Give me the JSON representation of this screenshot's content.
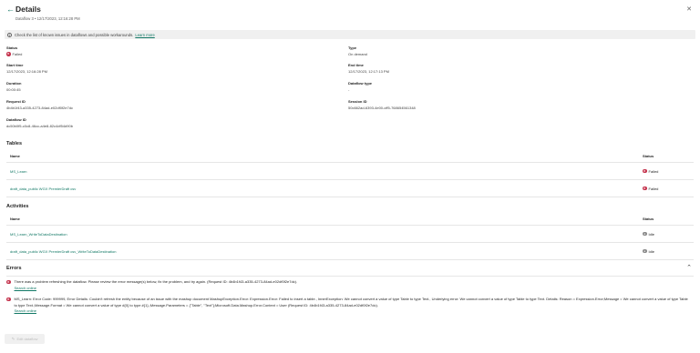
{
  "header": {
    "title": "Details",
    "subtitle": "Dataflow 3 • 12/17/2023, 12:16:28 PM",
    "back_glyph": "←",
    "close_glyph": "✕"
  },
  "banner": {
    "icon": "info-icon",
    "text": "Check the list of known issues in dataflows and possible workarounds.",
    "link": "Learn more"
  },
  "properties": {
    "status": {
      "label": "Status",
      "value": "Failed"
    },
    "type": {
      "label": "Type",
      "value": "On demand"
    },
    "start_time": {
      "label": "Start time",
      "value": "12/17/2023, 12:16:28 PM"
    },
    "end_time": {
      "label": "End time",
      "value": "12/17/2023, 12:17:13 PM"
    },
    "duration": {
      "label": "Duration",
      "value": "00:00:45"
    },
    "dataflow_type": {
      "label": "Dataflow type",
      "value": "-"
    },
    "request_id": {
      "label": "Request ID",
      "value": "4b4b1f43-a335-4273-84ad-e02df0f2e7dc"
    },
    "session_id": {
      "label": "Session ID",
      "value": "50c662ad-6393-4e00-cff5-768654561348"
    },
    "dataflow_id": {
      "label": "Dataflow ID",
      "value": "dc50b0f5-c0c8-46cc-a4e8-82c4df54d90b"
    }
  },
  "tables": {
    "title": "Tables",
    "headers": {
      "name": "Name",
      "status": "Status"
    },
    "rows": [
      {
        "name": "MS_Learn",
        "status": "Failed"
      },
      {
        "name": "draft_data_public WGX PremierDraft csv",
        "status": "Failed"
      }
    ]
  },
  "activities": {
    "title": "Activities",
    "headers": {
      "name": "Name",
      "status": "Status"
    },
    "rows": [
      {
        "name": "MS_Learn_WriteToDataDestination",
        "status": "Idle"
      },
      {
        "name": "draft_data_public WGX PremierDraft csv_WriteToDataDestination",
        "status": "Idle"
      }
    ]
  },
  "errors": {
    "title": "Errors",
    "items": [
      {
        "text": "There was a problem refreshing the dataflow. Please review the error message(s) below, fix the problem, and try again. (Request ID: 4b4b1f43-a335-4273-84ad-e02df0f2e7dc).",
        "link": "Search online"
      },
      {
        "text": "MS_Learn: Error Code: 999999, Error Details: Couldn't refresh the entity because of an issue with the mashup document MashupException.Error: Expression.Error: Failed to insert a table., InnerException: We cannot convert a value of type Table to type Text., Underlying error: We cannot convert a value of type Table to type Text. Details: Reason = Expression.Error;Message = We cannot convert a value of type Table to type Text.;Message.Format = We cannot convert a value of type #{0} to type #{1}.;Message.Parameters = {\"Table\", \"Text\"};Microsoft.Data.Mashup.Error.Context = User (Request ID: 4b4b1f43-a335-4273-84ad-e02df0f2e7dc).",
        "link": "Search online"
      }
    ]
  },
  "footer": {
    "edit_button": "Edit dataflow"
  },
  "colors": {
    "accent": "#117865",
    "error": "#c4314b",
    "idle": "#8a8a8a"
  }
}
